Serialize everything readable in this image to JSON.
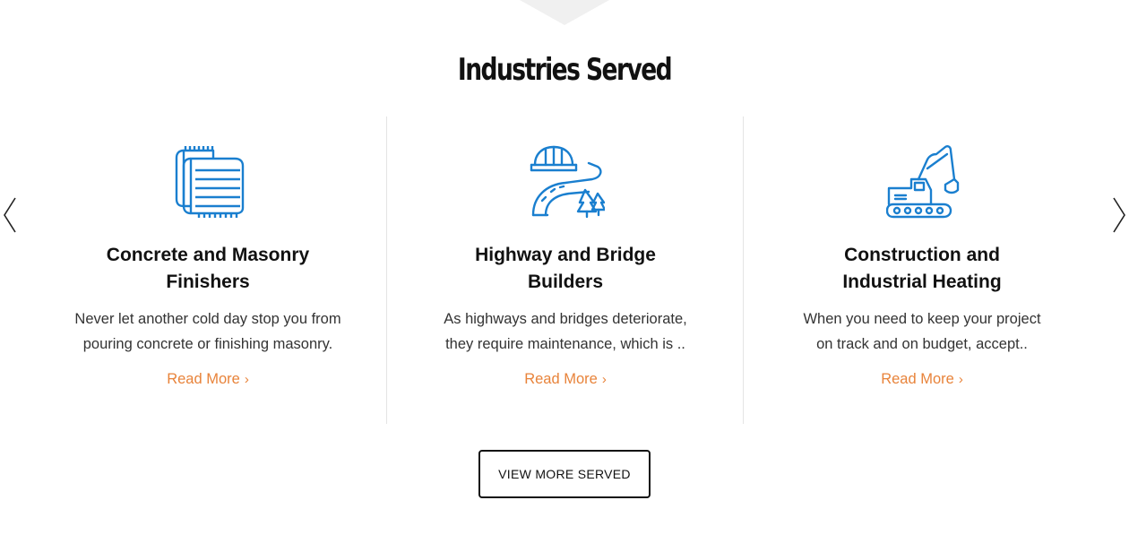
{
  "section": {
    "title": "Industries Served"
  },
  "colors": {
    "accent": "#e8833a",
    "icon": "#1a7fcf",
    "title": "#111111",
    "divider": "#e4e4e4"
  },
  "carousel": {
    "prev_icon": "chevron-left-icon",
    "next_icon": "chevron-right-icon"
  },
  "cards": [
    {
      "icon": "masonry-blocks-icon",
      "title_line1": "Concrete and Masonry",
      "title_line2": "Finishers",
      "desc_line1": "Never let another cold day stop you from",
      "desc_line2": "pouring concrete or finishing masonry.",
      "link_label": "Read More"
    },
    {
      "icon": "highway-bridge-icon",
      "title_line1": "Highway and Bridge",
      "title_line2": "Builders",
      "desc_line1": "As highways and bridges deteriorate,",
      "desc_line2": "they require maintenance, which is ..",
      "link_label": "Read More"
    },
    {
      "icon": "excavator-icon",
      "title_line1": "Construction and",
      "title_line2": "Industrial Heating",
      "desc_line1": "When you need to keep your project",
      "desc_line2": "on track and on budget, accept..",
      "link_label": "Read More"
    }
  ],
  "footer": {
    "button_label": "VIEW MORE SERVED"
  }
}
